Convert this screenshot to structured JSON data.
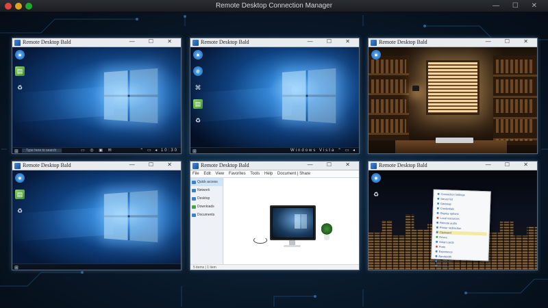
{
  "app": {
    "title": "Remote Desktop Connection Manager",
    "window_controls": "— ☐ ✕"
  },
  "sessions": [
    {
      "title": "Remote Desktop Bald",
      "kind": "windows-desktop",
      "controls": "— ☐ ✕",
      "taskbar": {
        "start": "⊞",
        "search": "Type here to search",
        "icons": "▭ ◎ ▣ ✉",
        "tray": "⌃ ▭ ◂ 10:30"
      }
    },
    {
      "title": "Remote Desktop Bald",
      "kind": "windows-desktop",
      "controls": "— ☐ ✕",
      "taskbar": {
        "start": "⊞",
        "search": "",
        "icons": "",
        "tray": "Windows Vista ⌃ ▭ ◂"
      }
    },
    {
      "title": "Remote Desktop Bald",
      "kind": "room-photo",
      "controls": "— ☐ ✕"
    },
    {
      "title": "Remote Desktop Bald",
      "kind": "windows-desktop",
      "controls": "— ☐ ✕",
      "taskbar": {
        "start": "⊞",
        "search": "",
        "icons": "",
        "tray": ""
      }
    },
    {
      "title": "Remote Desktop Bald",
      "kind": "file-explorer",
      "controls": "— ☐ ✕",
      "toolbar": [
        "File",
        "Edit",
        "View",
        "Favorites",
        "Tools",
        "Help"
      ],
      "toolbar_right": "Document | Share",
      "nav_items": [
        {
          "label": "Quick access",
          "variant": "sel"
        },
        {
          "label": "Network",
          "variant": ""
        },
        {
          "label": "Desktop",
          "variant": ""
        },
        {
          "label": "Downloads",
          "variant": "green"
        },
        {
          "label": "Documents",
          "variant": ""
        }
      ],
      "status": "5 items  |  1 item"
    },
    {
      "title": "Remote Desktop Bald",
      "kind": "city-notes",
      "controls": "— ☐ ✕",
      "notes": [
        {
          "text": "Connection settings",
          "variant": ""
        },
        {
          "text": "Server list",
          "variant": ""
        },
        {
          "text": "Gateway",
          "variant": ""
        },
        {
          "text": "Credentials",
          "variant": ""
        },
        {
          "text": "Display options",
          "variant": ""
        },
        {
          "text": "Local resources",
          "variant": "red"
        },
        {
          "text": "Remote audio",
          "variant": ""
        },
        {
          "text": "Printer redirection",
          "variant": ""
        },
        {
          "text": "Clipboard",
          "variant": "hl"
        },
        {
          "text": "Drives",
          "variant": "green"
        },
        {
          "text": "Smart cards",
          "variant": ""
        },
        {
          "text": "Ports",
          "variant": "red"
        },
        {
          "text": "Experience",
          "variant": ""
        },
        {
          "text": "Bandwidth",
          "variant": ""
        },
        {
          "text": "Reconnect",
          "variant": ""
        },
        {
          "text": "Advanced",
          "variant": ""
        }
      ]
    }
  ],
  "icons": {
    "desktop_1": [
      "globe-icon",
      "folder-icon",
      "recycle-bin-icon"
    ],
    "desktop_2": [
      "globe-icon",
      "edge-icon",
      "terminal-icon",
      "folder-icon",
      "recycle-bin-icon"
    ],
    "desktop_3": [
      "globe-icon",
      "recycle-bin-icon"
    ],
    "desktop_4": [
      "globe-icon",
      "folder-icon",
      "recycle-bin-icon"
    ],
    "desktop_6": [
      "globe-icon",
      "recycle-bin-icon"
    ]
  },
  "colors": {
    "accent": "#3c8be0",
    "background": "#06101c",
    "titlebar": "#e9ecef"
  }
}
